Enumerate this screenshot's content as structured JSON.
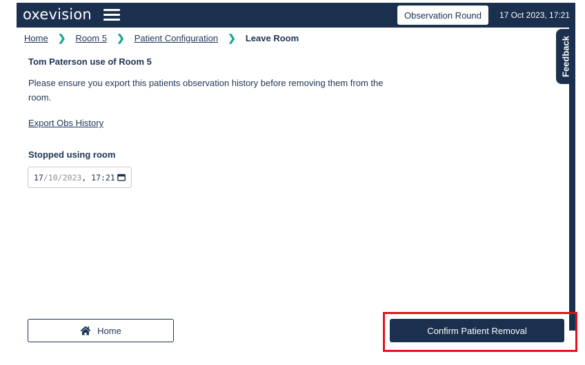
{
  "header": {
    "logo": "oxevision",
    "menu_icon": "hamburger-menu-icon",
    "observation_round_label": "Observation Round",
    "datetime": "17 Oct 2023, 17:21"
  },
  "feedback": {
    "label": "Feedback"
  },
  "breadcrumb": {
    "items": [
      "Home",
      "Room 5",
      "Patient Configuration"
    ],
    "current": "Leave Room",
    "separator_icon": "chevron-right-icon"
  },
  "content": {
    "heading": "Tom Paterson use of Room 5",
    "info_text": "Please ensure you export this patients observation history before removing them from the room.",
    "export_link": "Export Obs History",
    "stopped_label": "Stopped using room",
    "date_input": {
      "day": "17",
      "sep1": "/",
      "month": "10",
      "sep2": "/",
      "year": "2023",
      "comma": ", ",
      "time": "17:21",
      "icon": "calendar-icon"
    }
  },
  "footer": {
    "home_button_label": "Home",
    "home_icon": "home-icon",
    "confirm_button_label": "Confirm Patient Removal"
  },
  "colors": {
    "navy": "#1b2f4e",
    "teal_accent": "#12a58c",
    "highlight_red": "#e4101d"
  }
}
